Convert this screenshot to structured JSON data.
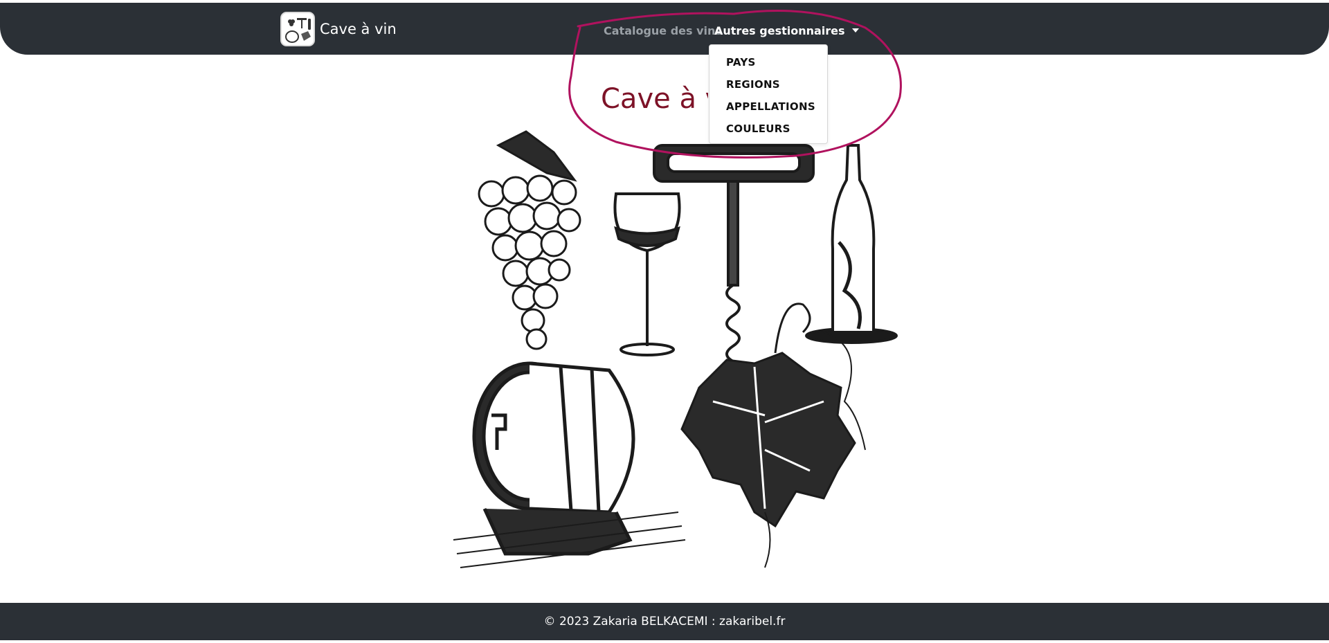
{
  "brand": {
    "name": "Cave à vin",
    "logo_icon": "wine-collage-logo-icon"
  },
  "nav": {
    "catalogue_label": "Catalogue des vins",
    "autres_label": "Autres gestionnaires",
    "caret_icon": "caret-down-icon",
    "dropdown_items": [
      {
        "label": "PAYS"
      },
      {
        "label": "REGIONS"
      },
      {
        "label": "APPELLATIONS"
      },
      {
        "label": "COULEURS"
      }
    ]
  },
  "main": {
    "heading": "Cave à vin",
    "illustration_icons": [
      "grapes-icon",
      "wine-glass-icon",
      "corkscrew-icon",
      "wine-bottle-icon",
      "barrel-icon",
      "vine-leaf-icon"
    ]
  },
  "footer": {
    "text": "© 2023 Zakaria BELKACEMI : zakaribel.fr"
  },
  "colors": {
    "navbar_bg": "#2b3036",
    "heading": "#7d1227",
    "annotation_stroke": "#b0125e",
    "nav_inactive": "#9aa0a6"
  }
}
